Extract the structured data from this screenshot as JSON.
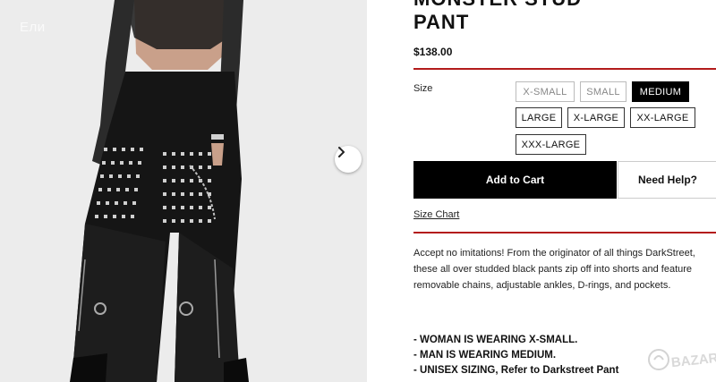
{
  "product": {
    "title_line1": "MONSTER STUD",
    "title_line2": "PANT",
    "price": "$138.00"
  },
  "gallery": {
    "watermark": "Ели",
    "next_icon": "chevron-right-icon"
  },
  "size": {
    "label": "Size",
    "options": [
      "X-SMALL",
      "SMALL",
      "MEDIUM",
      "LARGE",
      "X-LARGE",
      "XX-LARGE",
      "XXX-LARGE"
    ],
    "selected": "MEDIUM",
    "unavailable": [
      "X-SMALL",
      "SMALL"
    ]
  },
  "actions": {
    "add_to_cart": "Add to Cart",
    "need_help": "Need Help?",
    "size_chart": "Size Chart"
  },
  "description": "Accept no imitations! From the originator of all things DarkStreet, these all over studded black pants zip off into shorts and feature removable chains, adjustable ankles, D-rings, and  pockets.",
  "notes": [
    "- WOMAN IS WEARING X-SMALL.",
    "- MAN IS WEARING MEDIUM.",
    "- UNISEX SIZING, Refer to Darkstreet Pant"
  ],
  "badge": {
    "text": "BAZAR"
  },
  "colors": {
    "accent_rule": "#b31b1b",
    "selected_bg": "#000000",
    "photo_bg": "#e9e9e9"
  }
}
